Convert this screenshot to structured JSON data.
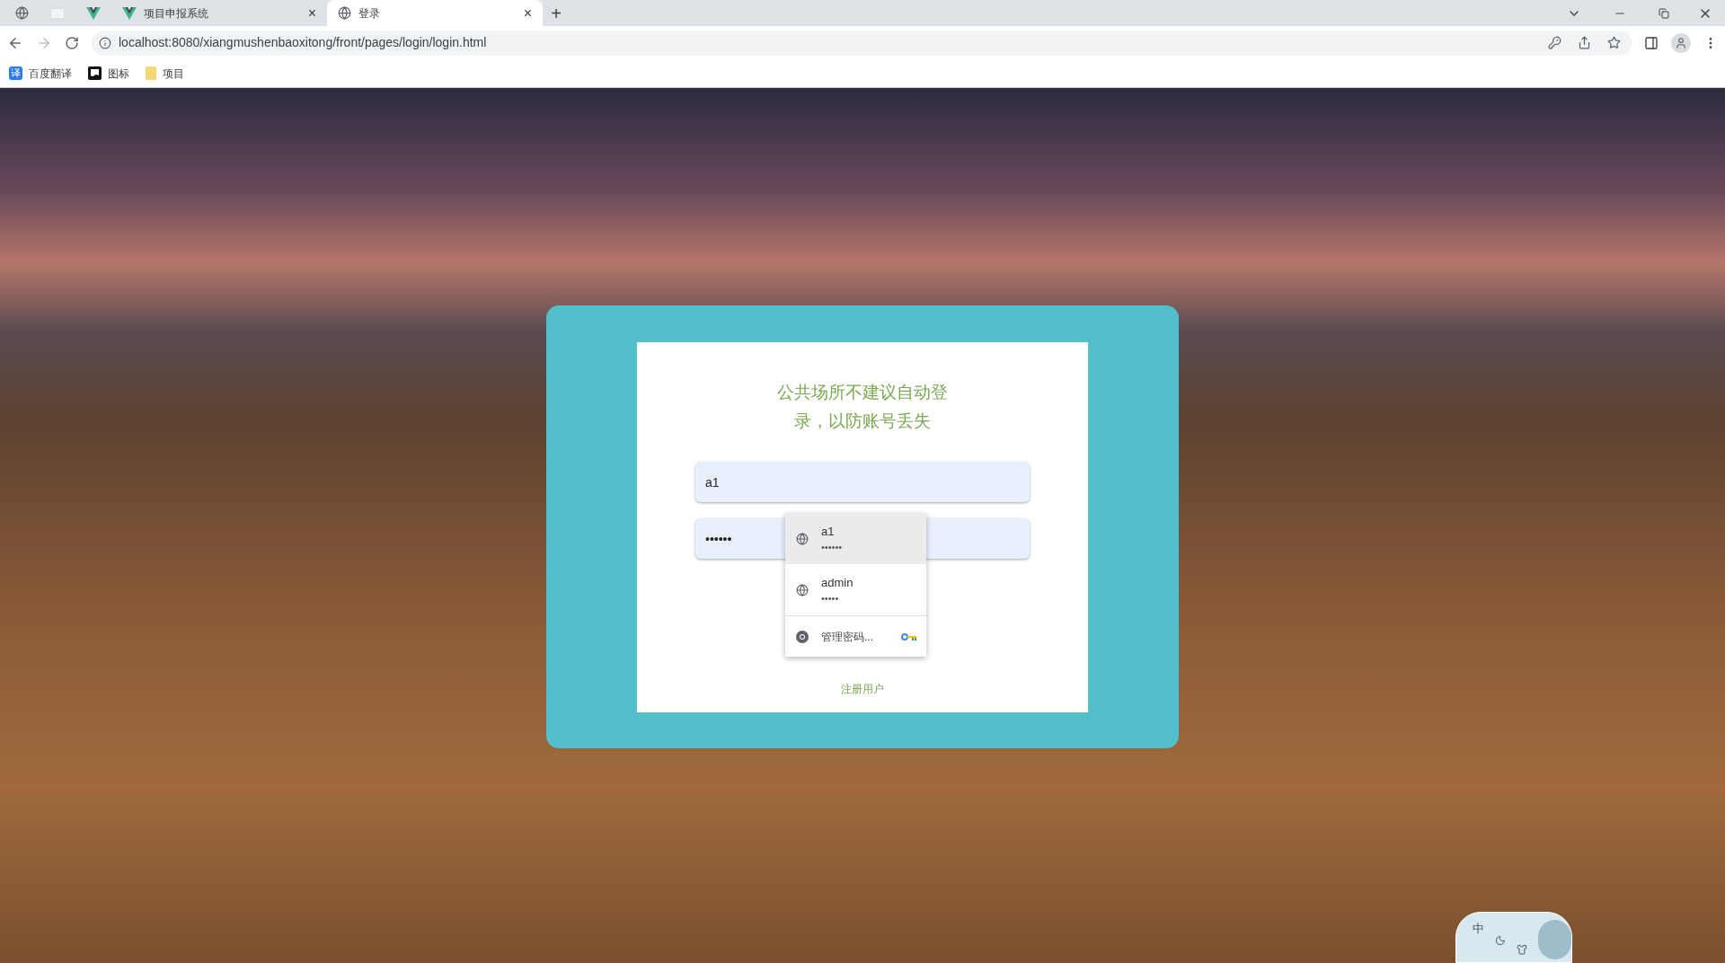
{
  "tabs": [
    {
      "kind": "globe",
      "selected": false
    },
    {
      "kind": "blank",
      "selected": false
    },
    {
      "kind": "vue",
      "selected": false
    },
    {
      "kind": "vue",
      "title": "项目申报系统",
      "close": "×",
      "selected": false
    },
    {
      "kind": "globe",
      "title": "登录",
      "close": "×",
      "selected": true
    }
  ],
  "new_tab": "+",
  "address_bar": {
    "url": "localhost:8080/xiangmushenbaoxitong/front/pages/login/login.html"
  },
  "bookmarks": [
    {
      "kind": "translate",
      "icon_text": "译",
      "label": "百度翻译"
    },
    {
      "kind": "flag",
      "label": "图标"
    },
    {
      "kind": "folder",
      "label": "项目"
    }
  ],
  "login": {
    "notice": "公共场所不建议自动登录，以防账号丢失",
    "username": {
      "value": "a1"
    },
    "password": {
      "value": "••••••"
    },
    "register_link": "注册用户"
  },
  "autofill": [
    {
      "kind": "credential",
      "username": "a1",
      "password": "••••••",
      "selected": true
    },
    {
      "kind": "credential",
      "username": "admin",
      "password": "•••••",
      "selected": false
    },
    {
      "kind": "manage",
      "label": "管理密码...",
      "selected": false
    }
  ],
  "ime": {
    "label": "中"
  }
}
